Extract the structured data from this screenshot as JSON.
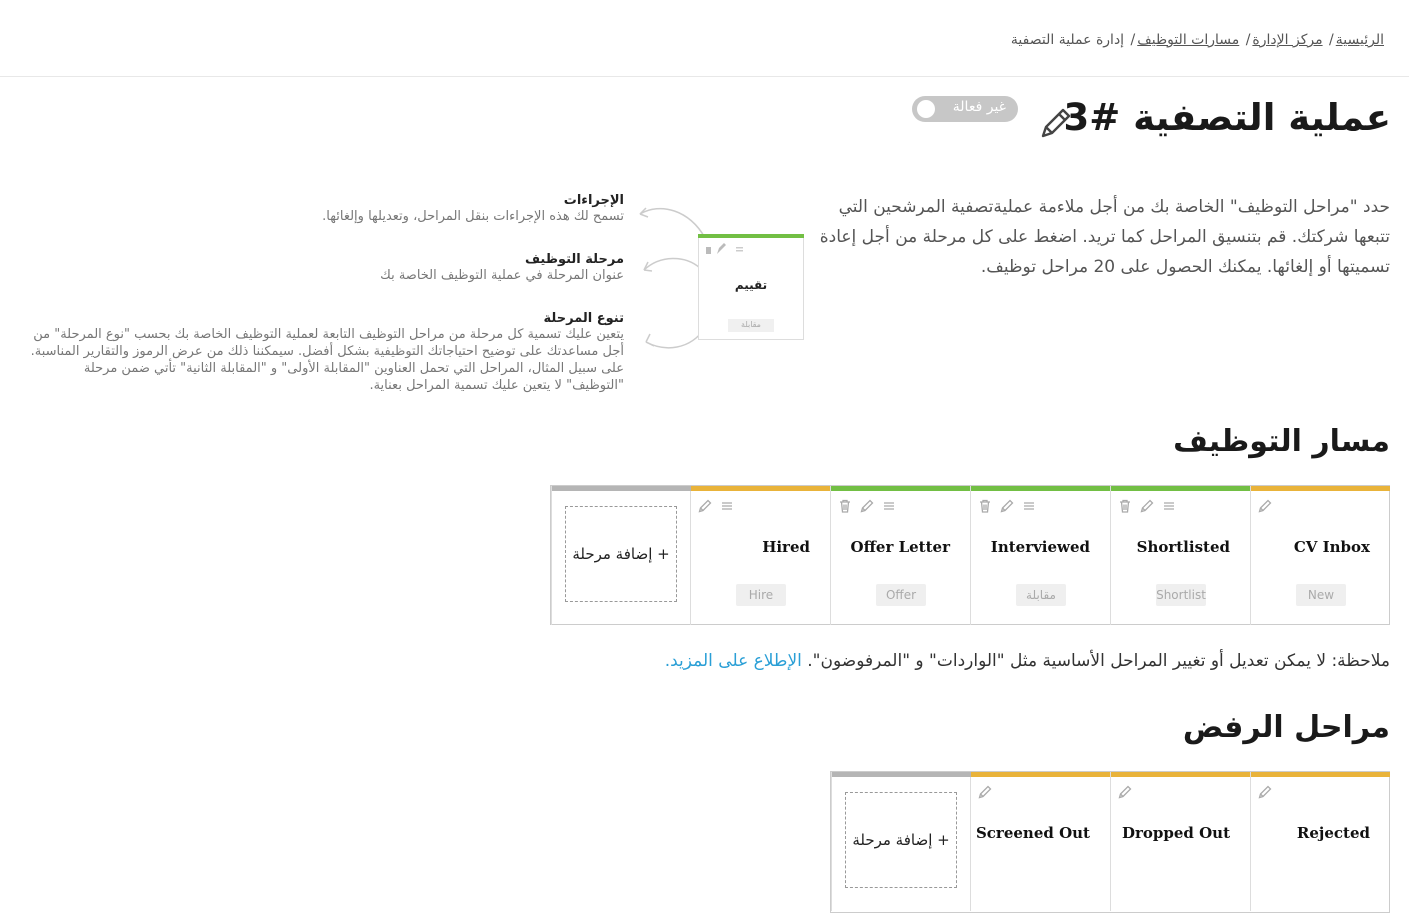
{
  "breadcrumb": {
    "items": [
      "الرئيسية",
      "مركز الإدارة",
      "مسارات التوظيف"
    ],
    "current": "إدارة عملية التصفية"
  },
  "header": {
    "title": "عملية التصفية #3",
    "status_label": "غير فعالة",
    "status_active": false
  },
  "intro": {
    "description": "حدد \"مراحل التوظيف\" الخاصة بك من أجل ملاءمة عمليةتصفية المرشحين التي تتبعها شركتك. قم بتنسيق المراحل كما تريد. اضغط على كل مرحلة من أجل إعادة تسميتها أو إلغائها. يمكنك الحصول على 20 مراحل توظيف."
  },
  "help": {
    "actions_title": "الإجراءات",
    "actions_text": "تسمح لك هذه الإجراءات بنقل المراحل، وتعديلها وإلغائها.",
    "stage_title": "مرحلة التوظيف",
    "stage_text": "عنوان المرحلة في عملية التوظيف الخاصة بك",
    "type_title": "تنوع المرحلة",
    "type_text": "يتعين عليك تسمية كل مرحلة من مراحل التوظيف التابعة لعملية التوظيف الخاصة بك بحسب \"نوع المرحلة\" من أجل مساعدتك على توضيح احتياجاتك التوظيفية بشكل أفضل. سيمكننا ذلك من عرض الرموز والتقارير المناسبة. على سبيل المثال، المراحل التي تحمل العناوين \"المقابلة الأولى\" و \"المقابلة الثانية\" تأتي ضمن مرحلة \"التوظيف\" لا يتعين عليك تسمية المراحل بعناية.",
    "preview_name": "تقييم",
    "preview_badge": "مقابلة"
  },
  "pipeline": {
    "heading": "مسار التوظيف",
    "add_label": "+ إضافة مرحلة",
    "stages": [
      {
        "name": "CV Inbox",
        "type": "New",
        "color": "#e9b33a",
        "deletable": false,
        "movable": false
      },
      {
        "name": "Shortlisted",
        "type": "Shortlist",
        "color": "#72bf44",
        "deletable": true,
        "movable": true
      },
      {
        "name": "Interviewed",
        "type": "مقابلة",
        "color": "#72bf44",
        "deletable": true,
        "movable": true
      },
      {
        "name": "Offer Letter",
        "type": "Offer",
        "color": "#72bf44",
        "deletable": true,
        "movable": true
      },
      {
        "name": "Hired",
        "type": "Hire",
        "color": "#e9b33a",
        "deletable": false,
        "movable": true
      }
    ],
    "add_color": "#b5b5b5"
  },
  "note": {
    "text": "ملاحظة: لا يمكن تعديل أو تغيير المراحل الأساسية مثل \"الواردات\" و \"المرفوضون\".",
    "link": "الإطلاع على المزيد."
  },
  "rejection": {
    "heading": "مراحل الرفض",
    "add_label": "+ إضافة مرحلة",
    "stages": [
      {
        "name": "Rejected",
        "color": "#e9b33a"
      },
      {
        "name": "Dropped Out",
        "color": "#e9b33a"
      },
      {
        "name": "Screened Out",
        "color": "#e9b33a"
      }
    ],
    "add_color": "#b5b5b5"
  }
}
